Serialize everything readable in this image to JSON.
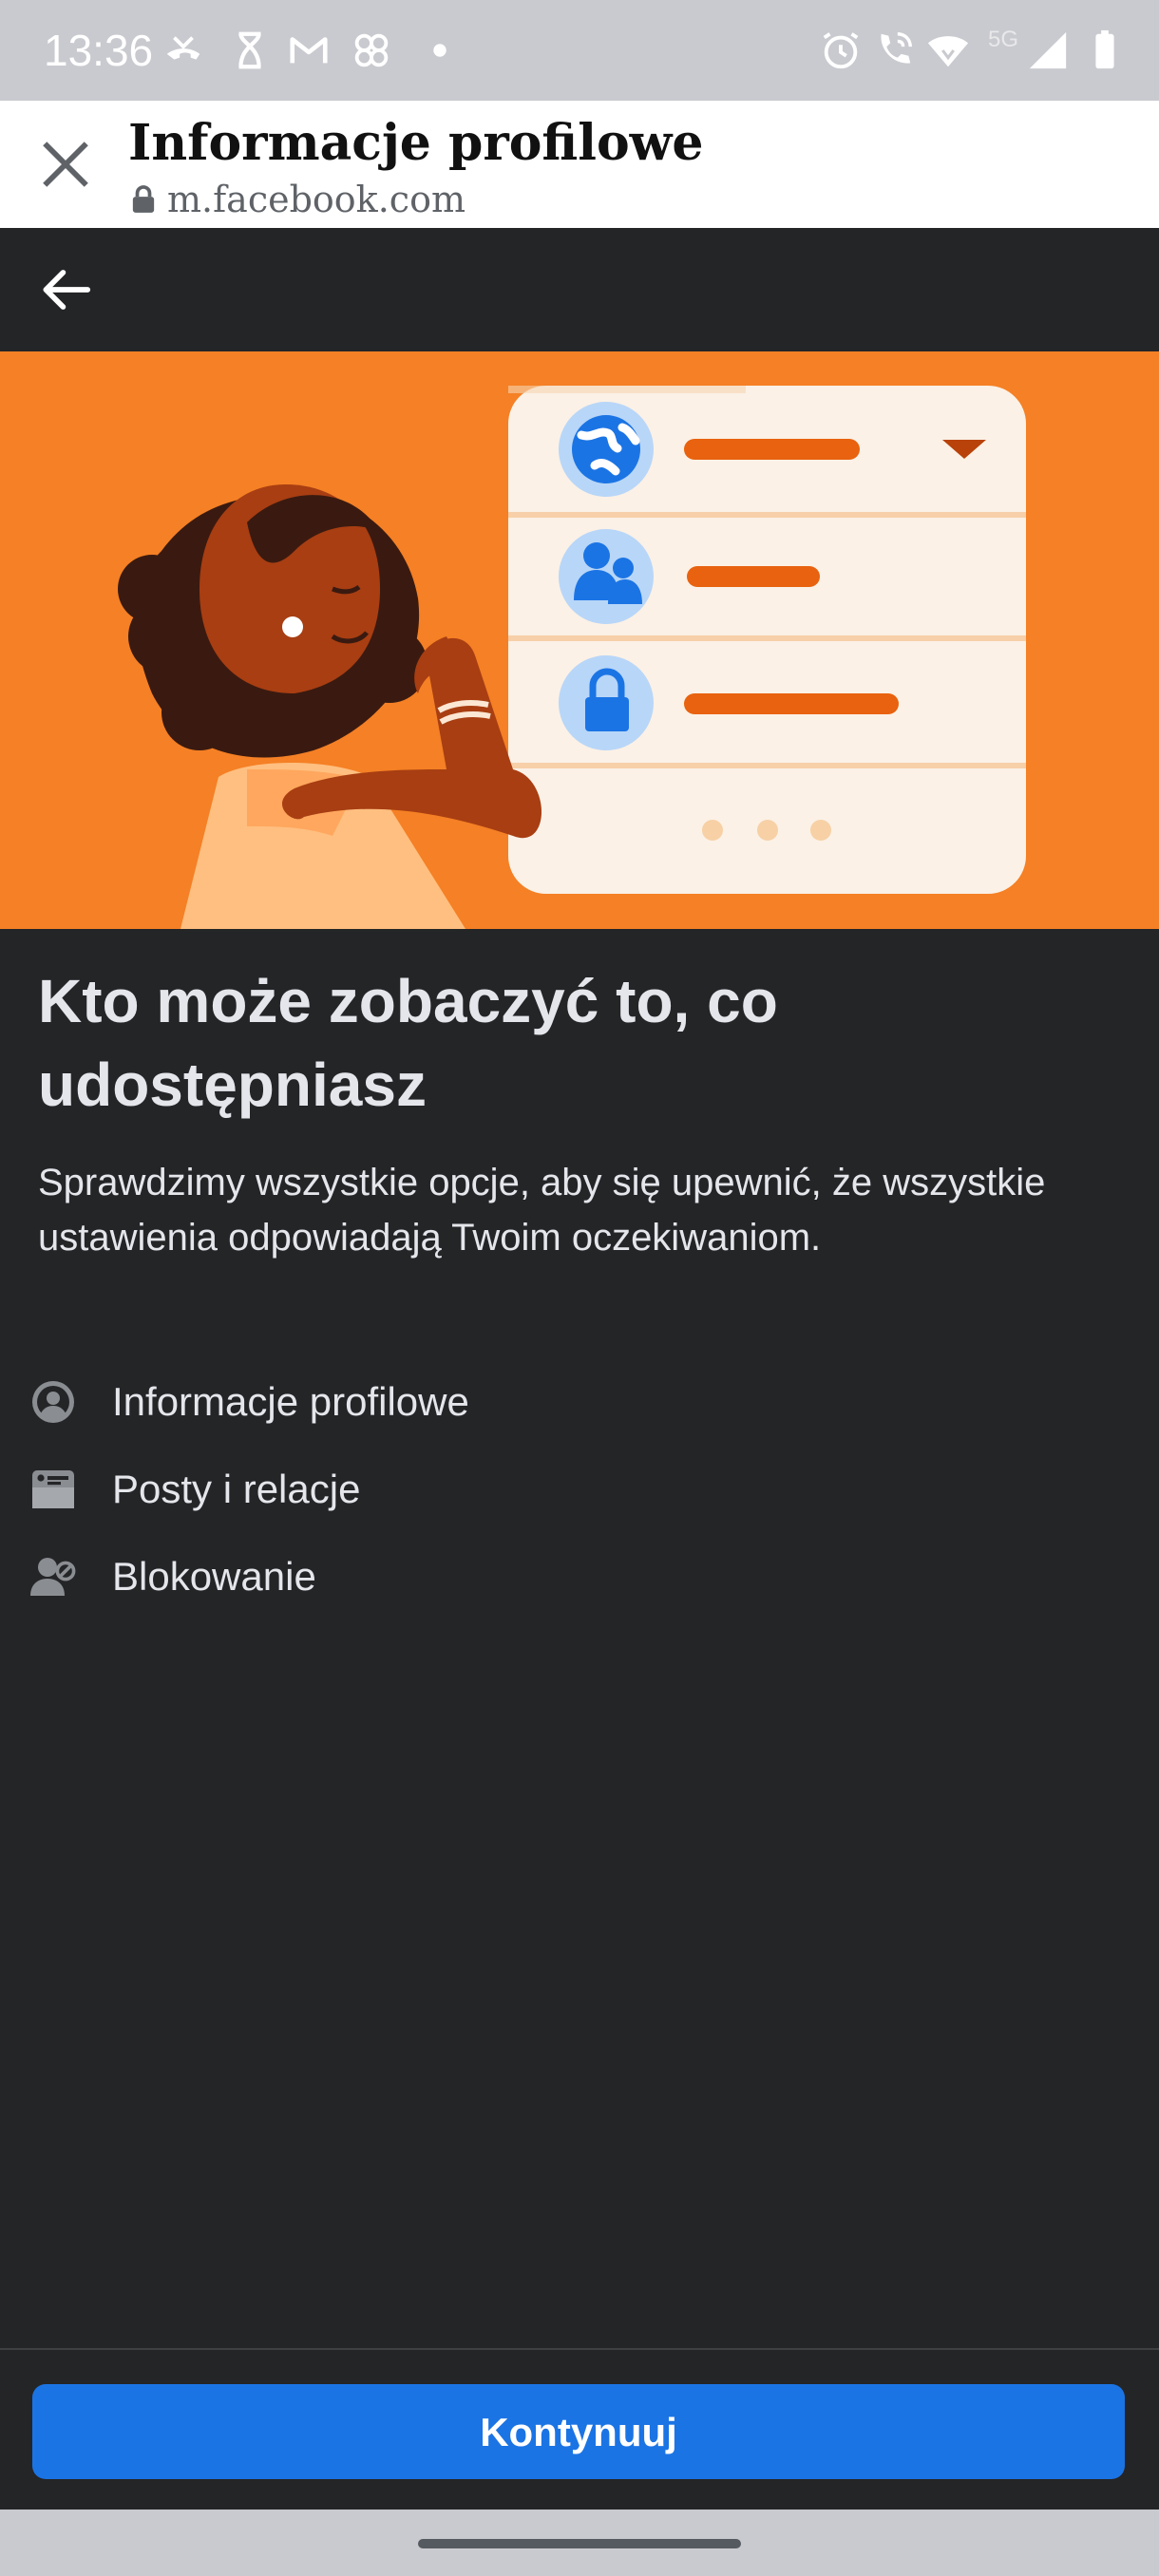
{
  "status_bar": {
    "time": "13:36",
    "network_label": "5G",
    "left_icons": [
      "missed-call-icon",
      "hourglass-icon",
      "gmail-icon",
      "pinwheel-icon",
      "dot-icon"
    ],
    "right_icons": [
      "alarm-icon",
      "wifi-calling-icon",
      "wifi-icon",
      "signal-icon",
      "battery-icon"
    ]
  },
  "browser": {
    "title": "Informacje profilowe",
    "url": "m.facebook.com"
  },
  "nav": {
    "back_icon": "arrow-left-icon"
  },
  "main": {
    "heading": "Kto może zobaczyć to, co udostępniasz",
    "description": "Sprawdzimy wszystkie opcje, aby się upewnić, że wszystkie ustawienia odpowiadają Twoim oczekiwaniom.",
    "items": [
      {
        "label": "Informacje profilowe",
        "icon": "profile-circle-icon"
      },
      {
        "label": "Posty i relacje",
        "icon": "posts-card-icon"
      },
      {
        "label": "Blokowanie",
        "icon": "block-user-icon"
      }
    ]
  },
  "footer": {
    "continue_label": "Kontynuuj"
  },
  "colors": {
    "accent": "#1b74e4",
    "hero_bg": "#f58025",
    "page_bg": "#242527"
  }
}
